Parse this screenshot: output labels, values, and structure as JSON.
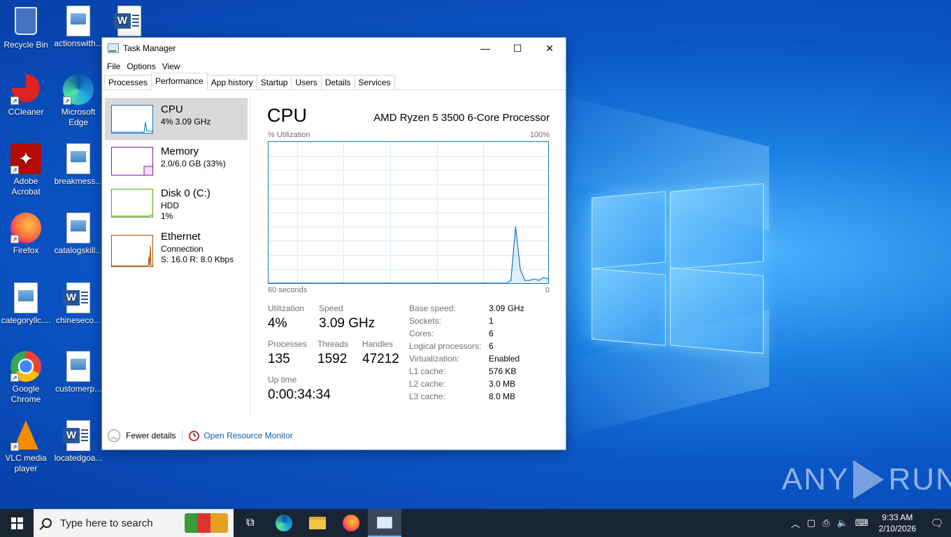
{
  "desktop": {
    "icons": [
      {
        "label": "Recycle Bin"
      },
      {
        "label": "actionswith..."
      },
      {
        "label": ""
      },
      {
        "label": "CCleaner"
      },
      {
        "label": "Microsoft Edge"
      },
      {
        "label": "Adobe Acrobat"
      },
      {
        "label": "breakmess..."
      },
      {
        "label": "Firefox"
      },
      {
        "label": "catalogskill..."
      },
      {
        "label": "categoryllc...."
      },
      {
        "label": "chineseco..."
      },
      {
        "label": "Google Chrome"
      },
      {
        "label": "customerp..."
      },
      {
        "label": "VLC media player"
      },
      {
        "label": "locatedgoa..."
      }
    ],
    "watermark": {
      "left": "ANY",
      "right": "RUN"
    }
  },
  "window": {
    "title": "Task Manager",
    "controls": {
      "minimize": "—",
      "maximize": "☐",
      "close": "✕"
    }
  },
  "menu": [
    "File",
    "Options",
    "View"
  ],
  "tabs": [
    "Processes",
    "Performance",
    "App history",
    "Startup",
    "Users",
    "Details",
    "Services"
  ],
  "active_tab": "Performance",
  "sidebar": [
    {
      "name": "CPU",
      "line1": "4%  3.09 GHz",
      "line2": "",
      "color": "#1177bb",
      "selected": true
    },
    {
      "name": "Memory",
      "line1": "2.0/6.0 GB (33%)",
      "line2": "",
      "color": "#8b12ae",
      "selected": false
    },
    {
      "name": "Disk 0 (C:)",
      "line1": "HDD",
      "line2": "1%",
      "color": "#4da60c",
      "selected": false
    },
    {
      "name": "Ethernet",
      "line1": "Connection",
      "line2": "S: 16.0  R: 8.0 Kbps",
      "color": "#a74f01",
      "selected": false
    }
  ],
  "cpu": {
    "heading": "CPU",
    "model": "AMD Ryzen 5 3500 6-Core Processor",
    "util_label": "% Utilization",
    "util_max": "100%",
    "axis_left": "60 seconds",
    "axis_right": "0",
    "stats": {
      "utilization_label": "Utilization",
      "utilization": "4%",
      "speed_label": "Speed",
      "speed": "3.09 GHz",
      "processes_label": "Processes",
      "processes": "135",
      "threads_label": "Threads",
      "threads": "1592",
      "handles_label": "Handles",
      "handles": "47212",
      "uptime_label": "Up time",
      "uptime": "0:00:34:34"
    },
    "details": [
      {
        "k": "Base speed:",
        "v": "3.09 GHz"
      },
      {
        "k": "Sockets:",
        "v": "1"
      },
      {
        "k": "Cores:",
        "v": "6"
      },
      {
        "k": "Logical processors:",
        "v": "6"
      },
      {
        "k": "Virtualization:",
        "v": "Enabled"
      },
      {
        "k": "L1 cache:",
        "v": "576 KB"
      },
      {
        "k": "L2 cache:",
        "v": "3.0 MB"
      },
      {
        "k": "L3 cache:",
        "v": "8.0 MB"
      }
    ],
    "history": [
      0,
      0,
      0,
      0,
      0,
      0,
      0,
      0,
      0,
      0,
      0,
      0,
      0,
      0,
      0,
      0,
      0,
      0,
      0,
      0,
      0,
      0,
      0,
      0,
      0,
      0,
      0,
      0,
      0,
      0,
      0,
      0,
      0,
      0,
      0,
      0,
      0,
      0,
      0,
      0,
      0,
      0,
      0,
      0,
      0,
      0,
      0,
      0,
      0,
      0,
      0,
      0,
      2,
      40,
      10,
      2,
      2,
      3,
      2,
      4,
      3
    ]
  },
  "footer": {
    "fewer_details": "Fewer details",
    "resource_monitor": "Open Resource Monitor"
  },
  "taskbar": {
    "search_placeholder": "Type here to search",
    "time": "9:33 AM",
    "date": "2/10/2026"
  }
}
